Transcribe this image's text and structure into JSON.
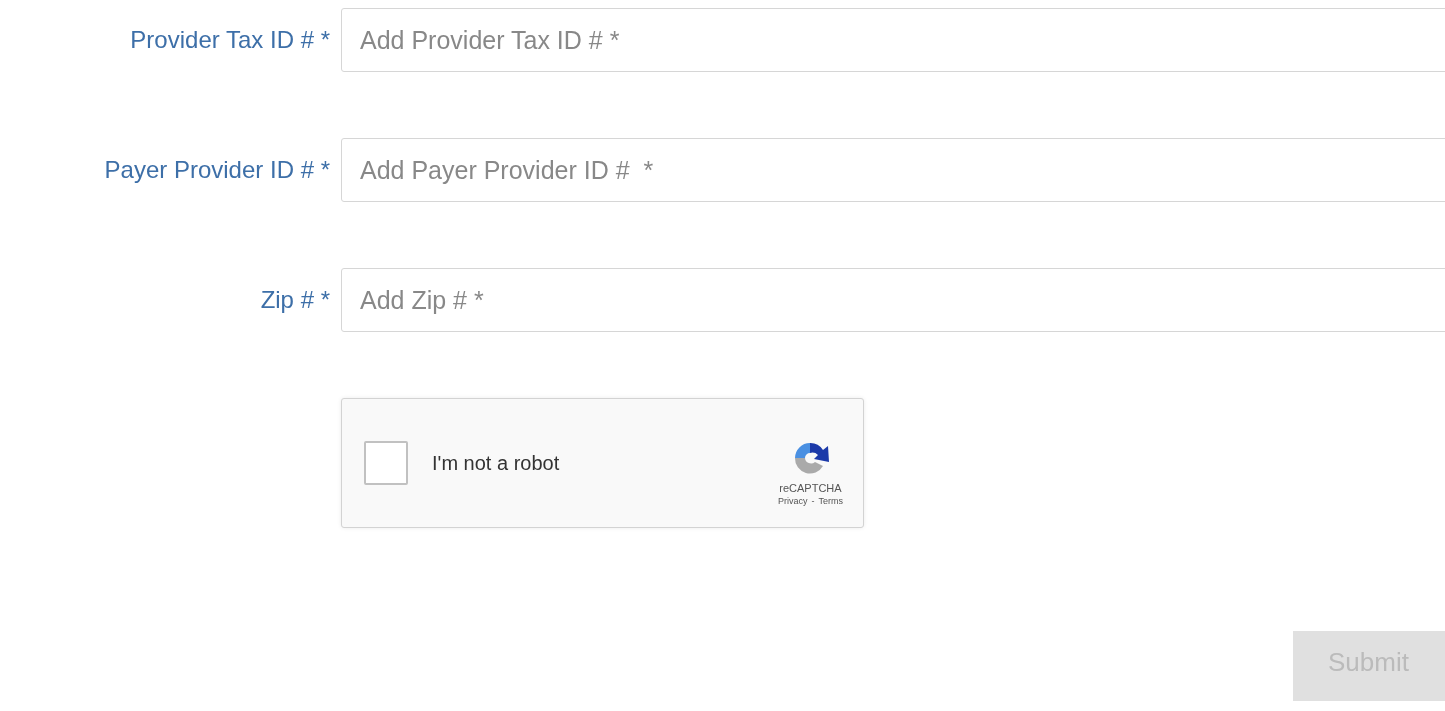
{
  "fields": [
    {
      "label": "Provider Tax ID # *",
      "placeholder": "Add Provider Tax ID # *"
    },
    {
      "label": "Payer Provider ID # *",
      "placeholder": "Add Payer Provider ID #  *"
    },
    {
      "label": "Zip # *",
      "placeholder": "Add Zip # *"
    }
  ],
  "captcha": {
    "label": "I'm not a robot",
    "checked": false,
    "brand": "reCAPTCHA",
    "links": [
      "Privacy",
      "Terms"
    ],
    "separator": "-"
  },
  "submit": {
    "label": "Submit",
    "disabled": true
  }
}
